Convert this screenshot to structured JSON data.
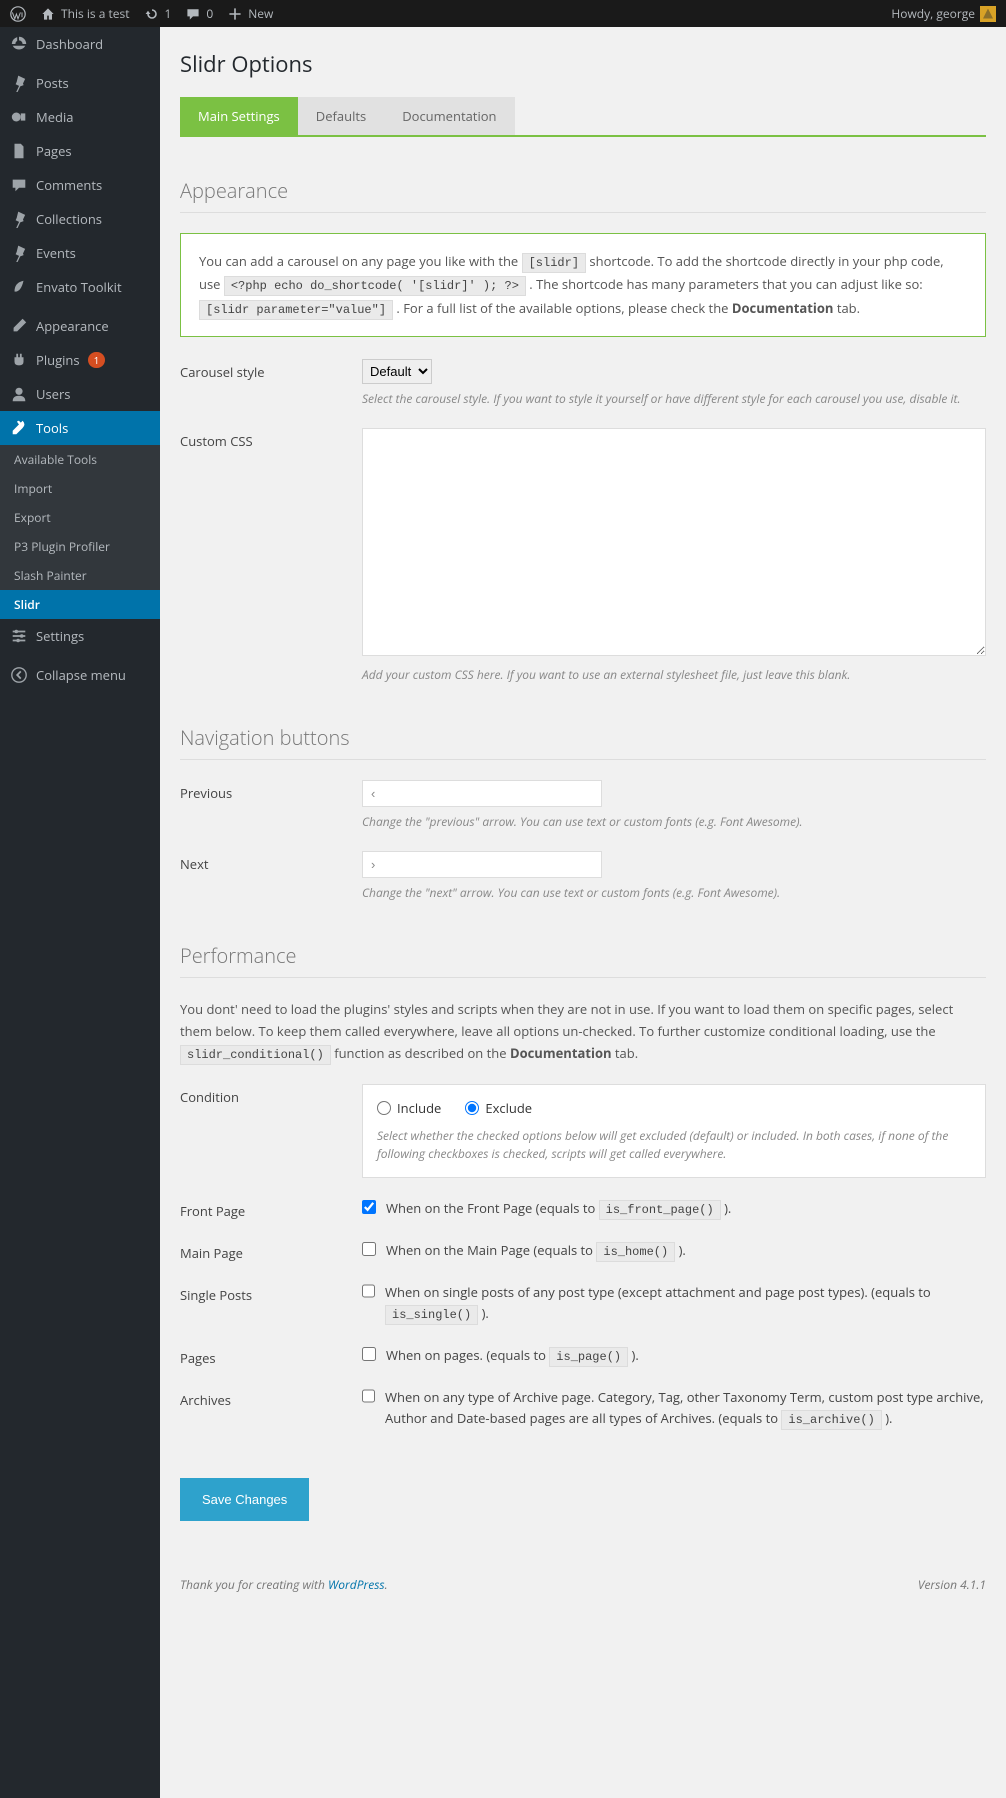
{
  "toolbar": {
    "site_name": "This is a test",
    "updates": "1",
    "comments": "0",
    "new": "New",
    "howdy": "Howdy, george"
  },
  "sidebar": {
    "items": [
      {
        "label": "Dashboard"
      },
      {
        "label": "Posts"
      },
      {
        "label": "Media"
      },
      {
        "label": "Pages"
      },
      {
        "label": "Comments"
      },
      {
        "label": "Collections"
      },
      {
        "label": "Events"
      },
      {
        "label": "Envato Toolkit"
      },
      {
        "label": "Appearance"
      },
      {
        "label": "Plugins",
        "badge": "1"
      },
      {
        "label": "Users"
      },
      {
        "label": "Tools"
      },
      {
        "label": "Settings"
      },
      {
        "label": "Collapse menu"
      }
    ],
    "tools_submenu": [
      "Available Tools",
      "Import",
      "Export",
      "P3 Plugin Profiler",
      "Slash Painter",
      "Slidr"
    ]
  },
  "page": {
    "title": "Slidr Options"
  },
  "tabs": [
    "Main Settings",
    "Defaults",
    "Documentation"
  ],
  "appearance": {
    "title": "Appearance",
    "info_p1a": "You can add a carousel on any page you like with the ",
    "info_code1": "[slidr]",
    "info_p1b": " shortcode. To add the shortcode directly in your php code, use ",
    "info_code2": "<?php echo do_shortcode( '[slidr]' ); ?>",
    "info_p1c": " . The shortcode has many parameters that you can adjust like so: ",
    "info_code3": "[slidr parameter=\"value\"]",
    "info_p1d": " . For a full list of the available options, please check the ",
    "info_strong": "Documentation",
    "info_p1e": " tab.",
    "carousel_label": "Carousel style",
    "carousel_option": "Default",
    "carousel_help": "Select the carousel style. If you want to style it yourself or have different style for each carousel you use, disable it.",
    "css_label": "Custom CSS",
    "css_help": "Add your custom CSS here. If you want to use an external stylesheet file, just leave this blank."
  },
  "nav": {
    "title": "Navigation buttons",
    "prev_label": "Previous",
    "prev_value": "‹",
    "prev_help": "Change the \"previous\" arrow. You can use text or custom fonts (e.g. Font Awesome).",
    "next_label": "Next",
    "next_value": "›",
    "next_help": "Change the \"next\" arrow. You can use text or custom fonts (e.g. Font Awesome)."
  },
  "perf": {
    "title": "Performance",
    "intro_a": "You dont' need to load the plugins' styles and scripts when they are not in use. If you want to load them on specific pages, select them below. To keep them called everywhere, leave all options un-checked. To further customize conditional loading, use the ",
    "intro_code": "slidr_conditional()",
    "intro_b": " function as described on the ",
    "intro_strong": "Documentation",
    "intro_c": " tab.",
    "cond_label": "Condition",
    "include": "Include",
    "exclude": "Exclude",
    "cond_help": "Select whether the checked options below will get excluded (default) or included. In both cases, if none of the following checkboxes is checked, scripts will get called everywhere.",
    "rows": {
      "front": {
        "label": "Front Page",
        "text_a": "When on the Front Page (equals to ",
        "code": "is_front_page()",
        "text_b": " )."
      },
      "main": {
        "label": "Main Page",
        "text_a": "When on the Main Page (equals to ",
        "code": "is_home()",
        "text_b": " )."
      },
      "single": {
        "label": "Single Posts",
        "text_a": "When on single posts of any post type (except attachment and page post types). (equals to ",
        "code": "is_single()",
        "text_b": " )."
      },
      "pages": {
        "label": "Pages",
        "text_a": "When on pages. (equals to ",
        "code": "is_page()",
        "text_b": " )."
      },
      "archives": {
        "label": "Archives",
        "text_a": "When on any type of Archive page. Category, Tag, other Taxonomy Term, custom post type archive, Author and Date-based pages are all types of Archives. (equals to ",
        "code": "is_archive()",
        "text_b": " )."
      }
    }
  },
  "save": "Save Changes",
  "footer": {
    "thanks": "Thank you for creating with ",
    "wp": "WordPress",
    "dot": ".",
    "version": "Version 4.1.1"
  }
}
